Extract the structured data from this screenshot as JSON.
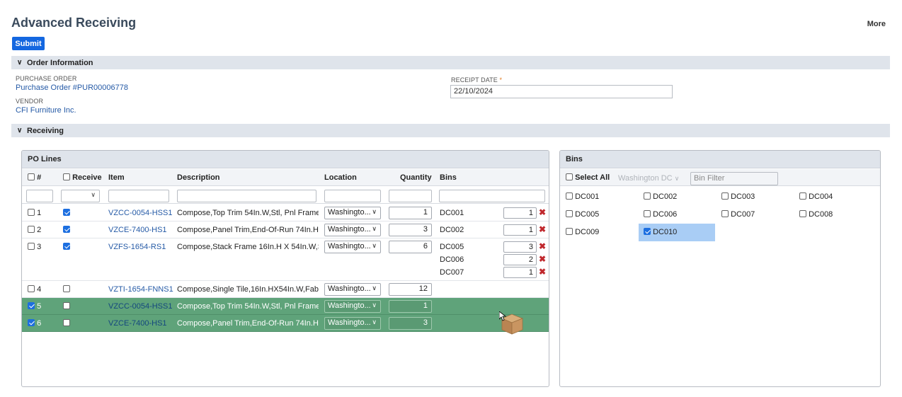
{
  "page": {
    "title": "Advanced Receiving",
    "more_label": "More",
    "submit_label": "Submit"
  },
  "order_info": {
    "section_label": "Order Information",
    "purchase_order_label": "PURCHASE ORDER",
    "purchase_order_value": "Purchase Order #PUR00006778",
    "vendor_label": "VENDOR",
    "vendor_value": "CFI Furniture Inc.",
    "receipt_date_label": "RECEIPT DATE",
    "receipt_date_required": "*",
    "receipt_date_value": "22/10/2024"
  },
  "receiving": {
    "section_label": "Receiving"
  },
  "po_lines": {
    "title": "PO Lines",
    "columns": {
      "num": "#",
      "receive": "Receive",
      "item": "Item",
      "description": "Description",
      "location": "Location",
      "quantity": "Quantity",
      "bins": "Bins"
    },
    "rows": [
      {
        "num": "1",
        "selected": false,
        "receive": true,
        "item": "VZCC-0054-HSS1",
        "description": "Compose,Top Trim 54In.W,Stl, Pnl Frame",
        "location": "Washingto...",
        "quantity": "1",
        "bins": [
          {
            "name": "DC001",
            "qty": "1"
          }
        ]
      },
      {
        "num": "2",
        "selected": false,
        "receive": true,
        "item": "VZCE-7400-HS1",
        "description": "Compose,Panel Trim,End-Of-Run 74In.H, ...",
        "location": "Washingto...",
        "quantity": "3",
        "bins": [
          {
            "name": "DC002",
            "qty": "1"
          }
        ]
      },
      {
        "num": "3",
        "selected": false,
        "receive": true,
        "item": "VZFS-1654-RS1",
        "description": "Compose,Stack Frame 16In.H X 54In.W,St...",
        "location": "Washingto...",
        "quantity": "6",
        "bins": [
          {
            "name": "DC005",
            "qty": "3"
          },
          {
            "name": "DC006",
            "qty": "2"
          },
          {
            "name": "DC007",
            "qty": "1"
          }
        ]
      },
      {
        "num": "4",
        "selected": false,
        "receive": false,
        "item": "VZTI-1654-FNNS1",
        "description": "Compose,Single Tile,16In.HX54In.W,Fabric...",
        "location": "Washingto...",
        "quantity": "12",
        "bins": []
      },
      {
        "num": "5",
        "selected": true,
        "receive": false,
        "item": "VZCC-0054-HSS1",
        "description": "Compose,Top Trim 54In.W,Stl, Pnl Frame",
        "location": "Washingto...",
        "quantity": "1",
        "bins": []
      },
      {
        "num": "6",
        "selected": true,
        "receive": false,
        "item": "VZCE-7400-HS1",
        "description": "Compose,Panel Trim,End-Of-Run 74In.H, ...",
        "location": "Washingto...",
        "quantity": "3",
        "bins": []
      }
    ]
  },
  "bins_panel": {
    "title": "Bins",
    "select_all_label": "Select All",
    "location_value": "Washington DC",
    "bin_filter_placeholder": "Bin Filter",
    "bins": [
      {
        "name": "DC001",
        "checked": false
      },
      {
        "name": "DC002",
        "checked": false
      },
      {
        "name": "DC003",
        "checked": false
      },
      {
        "name": "DC004",
        "checked": false
      },
      {
        "name": "DC005",
        "checked": false
      },
      {
        "name": "DC006",
        "checked": false
      },
      {
        "name": "DC007",
        "checked": false
      },
      {
        "name": "DC008",
        "checked": false
      },
      {
        "name": "DC009",
        "checked": false
      },
      {
        "name": "DC010",
        "checked": true
      }
    ]
  },
  "colors": {
    "accent": "#1467e0",
    "selected_row": "#5fa37a",
    "link": "#255aa6",
    "section_bg": "#dfe4eb",
    "delete": "#c0282d",
    "active_bin": "#a9cdf5"
  },
  "icons": {
    "section_toggle": "chevron-down-icon",
    "delete": "close-icon",
    "cursor_drag": "package-icon"
  }
}
